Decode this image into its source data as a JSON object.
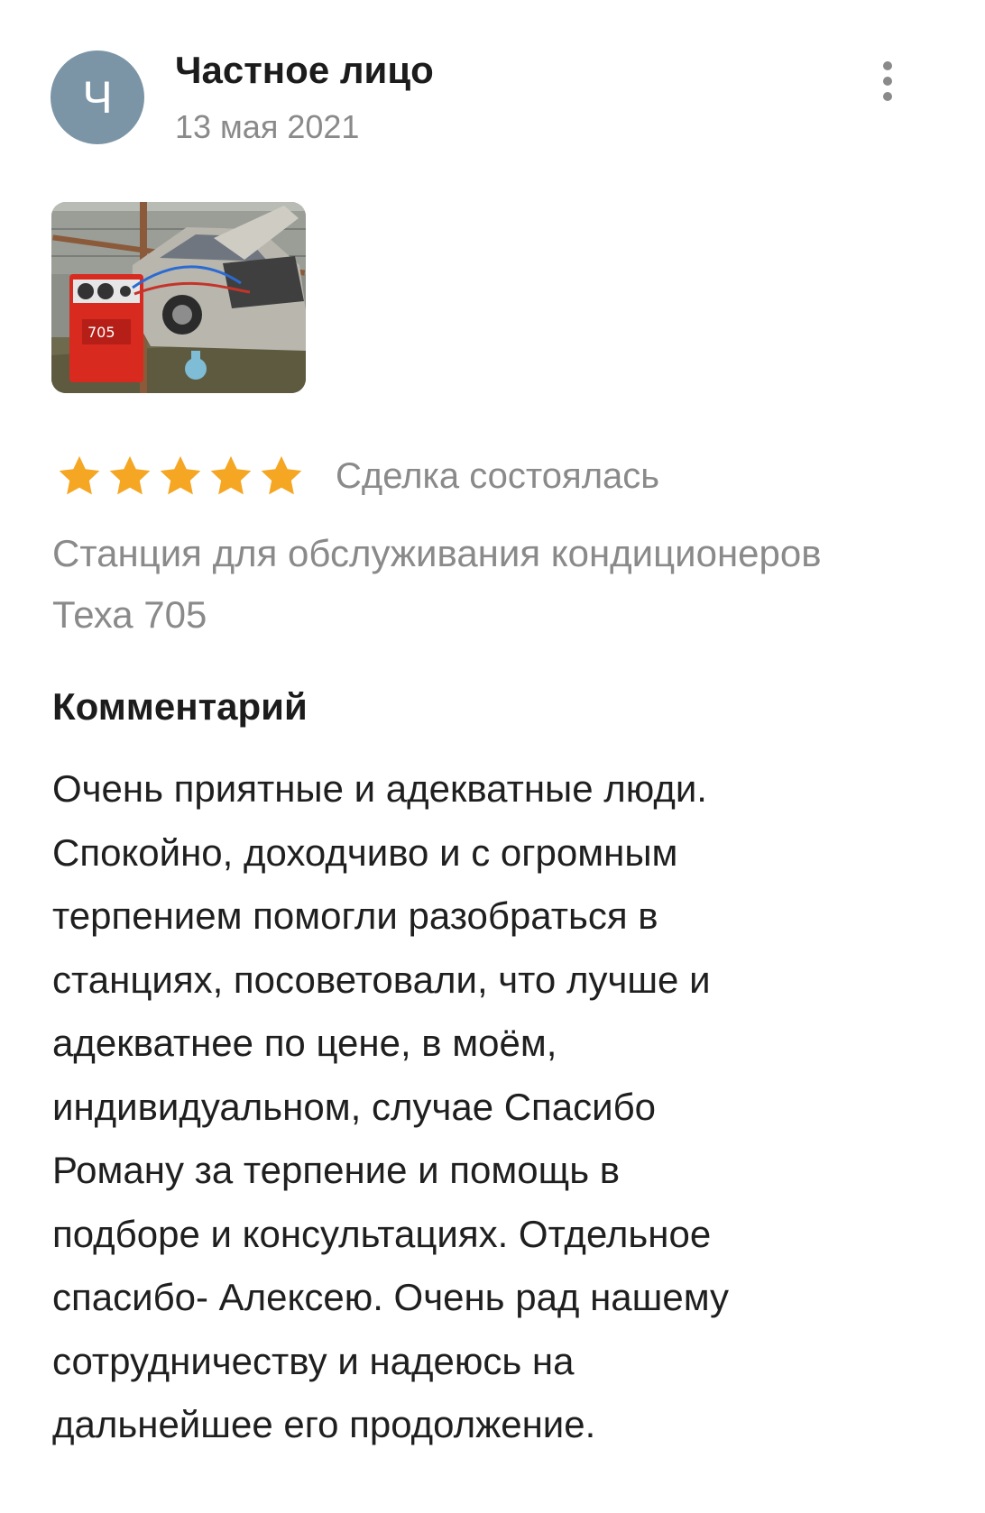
{
  "review": {
    "avatar_letter": "Ч",
    "author_name": "Частное лицо",
    "date": "13 мая 2021",
    "menu_icon": "more-vertical-icon",
    "rating": 5,
    "rating_max": 5,
    "deal_status": "Сделка состоялась",
    "product": "Станция для обслуживания кондиционеров Теха 705",
    "comment_heading": "Комментарий",
    "comment_lines": [
      "Очень приятные и адекватные люди.",
      "Спокойно, доходчиво и с огромным",
      "терпением помогли разобраться в",
      "станциях, посоветовали, что лучше и",
      "адекватнее по цене, в моём,",
      "индивидуальном, случае  Спасибо",
      "Роману за терпение и помощь в",
      "подборе и консультациях. Отдельное",
      "спасибо- Алексею. Очень рад нашему",
      "сотрудничеству и надеюсь на",
      "дальнейшее его продолжение."
    ]
  },
  "colors": {
    "avatar_bg": "#7b95a6",
    "star": "#f5a623",
    "muted_text": "#8a8a8a",
    "main_text": "#1f1f1f"
  }
}
